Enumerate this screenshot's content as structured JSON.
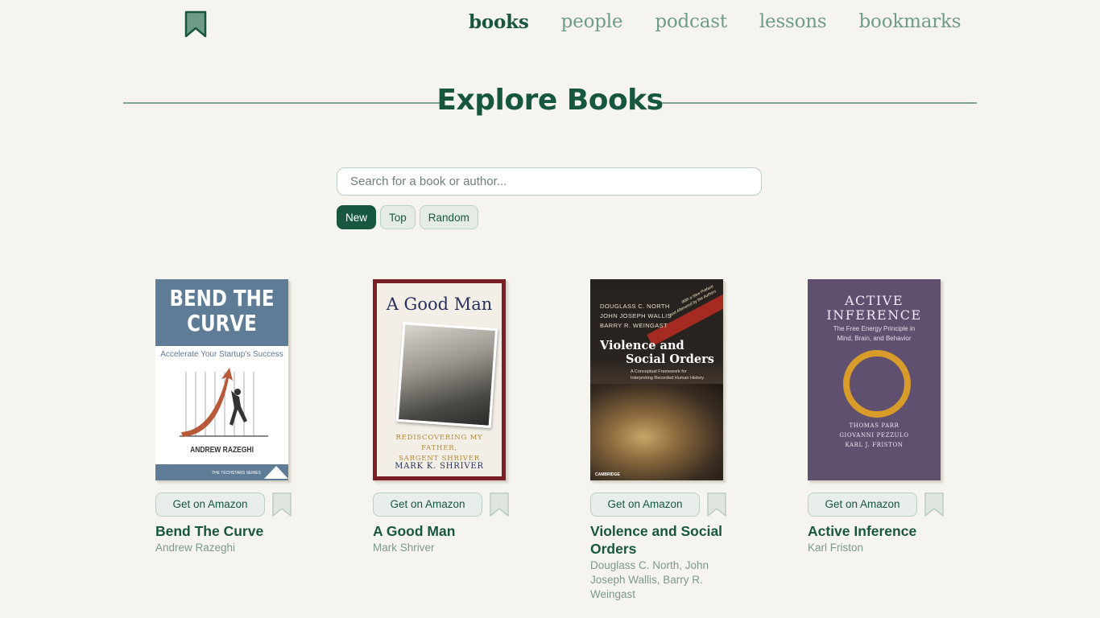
{
  "nav": {
    "items": [
      {
        "label": "books",
        "active": true
      },
      {
        "label": "people",
        "active": false
      },
      {
        "label": "podcast",
        "active": false
      },
      {
        "label": "lessons",
        "active": false
      },
      {
        "label": "bookmarks",
        "active": false
      }
    ]
  },
  "page": {
    "title": "Explore Books"
  },
  "search": {
    "placeholder": "Search for a book or author...",
    "value": ""
  },
  "filters": [
    {
      "label": "New",
      "active": true
    },
    {
      "label": "Top",
      "active": false
    },
    {
      "label": "Random",
      "active": false
    }
  ],
  "books": [
    {
      "title": "Bend The Curve",
      "author": "Andrew Razeghi",
      "amazon_label": "Get on Amazon",
      "cover": {
        "title_lines": [
          "BEND THE",
          "CURVE"
        ],
        "subtitle": "Accelerate Your Startup's Success",
        "author": "ANDREW RAZEGHI",
        "series": "THE TECHSTARS SERIES"
      }
    },
    {
      "title": "A Good Man",
      "author": "Mark Shriver",
      "amazon_label": "Get on Amazon",
      "cover": {
        "title": "A Good Man",
        "subtitle_lines": [
          "REDISCOVERING MY FATHER,",
          "SARGENT SHRIVER"
        ],
        "author": "MARK K. SHRIVER"
      }
    },
    {
      "title": "Violence and Social Orders",
      "author": "Douglass C. North, John Joseph Wallis, Barry R. Weingast",
      "amazon_label": "Get on Amazon",
      "cover": {
        "authors": [
          "DOUGLASS C. NORTH",
          "JOHN JOSEPH WALLIS",
          "BARRY R. WEINGAST"
        ],
        "title_lines": [
          "Violence and",
          "Social Orders"
        ],
        "subtitle_lines": [
          "A Conceptual Framework for",
          "Interpreting Recorded Human History"
        ],
        "band_lines": [
          "With a New Preface",
          "and Afterword by the Authors"
        ],
        "publisher": "CAMBRIDGE"
      }
    },
    {
      "title": "Active Inference",
      "author": "Karl Friston",
      "amazon_label": "Get on Amazon",
      "cover": {
        "title_lines": [
          "ACTIVE",
          "INFERENCE"
        ],
        "subtitle_lines": [
          "The Free Energy Principle in",
          "Mind, Brain, and Behavior"
        ],
        "authors": [
          "THOMAS PARR",
          "GIOVANNI PEZZULO",
          "KARL J. FRISTON"
        ]
      }
    }
  ],
  "colors": {
    "background": "#f6f4ef",
    "primary": "#17573f",
    "muted": "#6f9c86",
    "chip_bg": "#e5ece6",
    "bookmark_fill": "#dfe6e0"
  },
  "icons": {
    "logo": "bookmark-icon",
    "save": "bookmark-icon"
  }
}
